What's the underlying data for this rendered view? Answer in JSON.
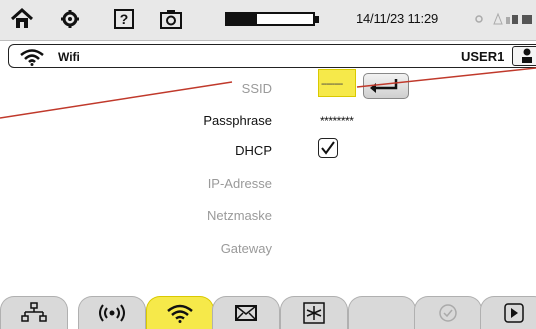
{
  "statusbar": {
    "datetime": "14/11/23 11:29",
    "battery_level_percent": 35,
    "icons": [
      "home-icon",
      "settings-icon",
      "help-icon",
      "camera-icon",
      "battery-icon",
      "sun-icon",
      "network-icon"
    ]
  },
  "header": {
    "icon": "wifi-icon",
    "title": "Wifi",
    "user": "USER1"
  },
  "form": {
    "ssid_label": "SSID",
    "ssid_value": "--------",
    "passphrase_label": "Passphrase",
    "passphrase_value": "********",
    "dhcp_label": "DHCP",
    "dhcp_checked": true,
    "ip_label": "IP-Adresse",
    "netmask_label": "Netzmaske",
    "gateway_label": "Gateway"
  },
  "tabs": [
    {
      "icon": "ethernet-icon",
      "active": false
    },
    {
      "icon": "wireless-signal-icon",
      "active": false
    },
    {
      "icon": "wifi-icon",
      "active": true
    },
    {
      "icon": "mail-icon",
      "active": false
    },
    {
      "icon": "network-star-icon",
      "active": false
    },
    {
      "icon": "blank",
      "active": false
    },
    {
      "icon": "check-circle-icon",
      "active": false
    },
    {
      "icon": "play-icon",
      "active": false
    }
  ],
  "colors": {
    "accent_yellow": "#f6e94a",
    "annotation_red": "#c0392b",
    "dimmed_text": "#9a9a9a"
  }
}
